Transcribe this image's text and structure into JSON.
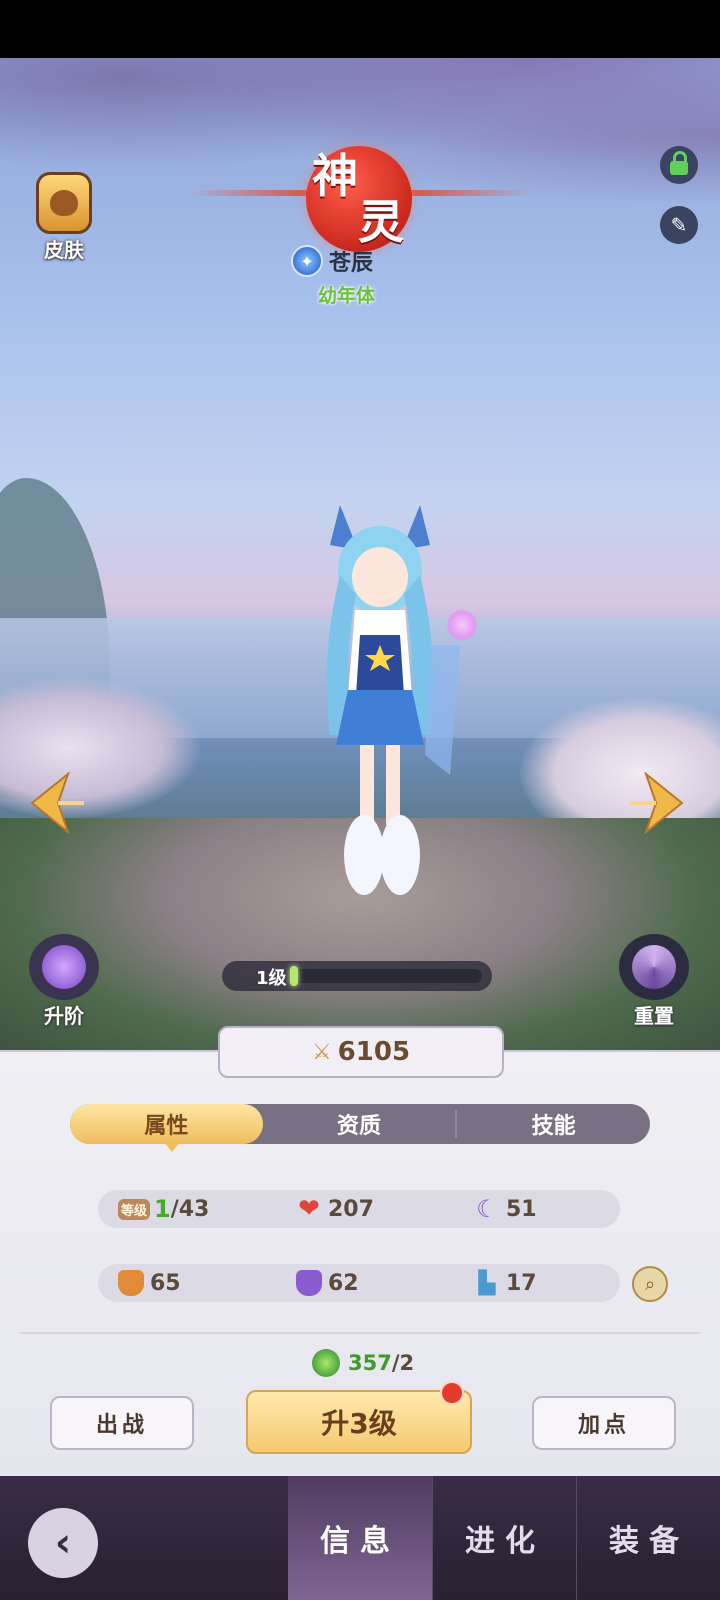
{
  "header": {
    "title_chars": [
      "神",
      "灵"
    ],
    "pet_name": "苍辰",
    "pet_stage": "幼年体"
  },
  "left_buttons": {
    "skin_label": "皮肤",
    "ascend_label": "升阶"
  },
  "right_buttons": {
    "reset_label": "重置"
  },
  "level_bar": {
    "label": "1级",
    "progress": 0.02
  },
  "power": {
    "value": "6105"
  },
  "tabs": [
    "属性",
    "资质",
    "技能"
  ],
  "active_tab": "属性",
  "stats": {
    "level_badge": "等级",
    "level_current": "1",
    "level_max": "/43",
    "hp": "207",
    "attack": "51",
    "defense": "65",
    "magic_defense": "62",
    "speed": "17"
  },
  "exp": {
    "current": "357",
    "max": "/2"
  },
  "actions": {
    "battle": "出战",
    "upgrade": "升3级",
    "add_points": "加点"
  },
  "bottom_nav": [
    "信息",
    "进化",
    "装备"
  ],
  "colors": {
    "accent_gold": "#f0bd5e",
    "title_red": "#d02b21",
    "stage_green": "#6bc23a"
  }
}
